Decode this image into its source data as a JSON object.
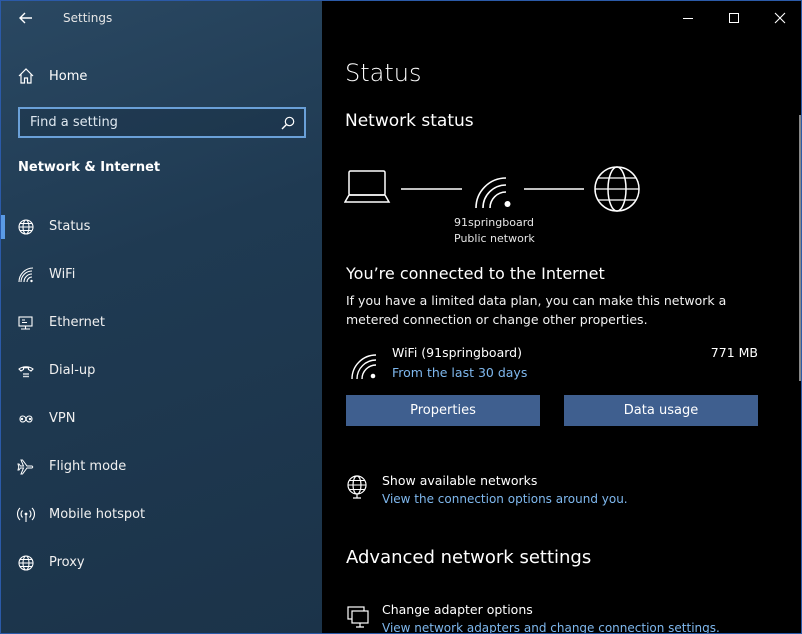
{
  "window": {
    "title": "Settings"
  },
  "sidebar": {
    "home_label": "Home",
    "search_placeholder": "Find a setting",
    "section_title": "Network & Internet",
    "items": [
      {
        "label": "Status",
        "icon": "globe-icon",
        "active": true
      },
      {
        "label": "WiFi",
        "icon": "wifi-icon"
      },
      {
        "label": "Ethernet",
        "icon": "ethernet-icon"
      },
      {
        "label": "Dial-up",
        "icon": "dialup-icon"
      },
      {
        "label": "VPN",
        "icon": "vpn-icon"
      },
      {
        "label": "Flight mode",
        "icon": "airplane-icon"
      },
      {
        "label": "Mobile hotspot",
        "icon": "hotspot-icon"
      },
      {
        "label": "Proxy",
        "icon": "globe-icon"
      }
    ]
  },
  "main": {
    "page_title": "Status",
    "network_status_heading": "Network status",
    "network": {
      "name": "91springboard",
      "type": "Public network"
    },
    "connected_heading": "You’re connected to the Internet",
    "connected_desc": "If you have a limited data plan, you can make this network a metered connection or change other properties.",
    "wifi": {
      "name": "WiFi (91springboard)",
      "period": "From the last 30 days",
      "usage": "771 MB"
    },
    "buttons": {
      "properties": "Properties",
      "data_usage": "Data usage"
    },
    "show_networks": {
      "title": "Show available networks",
      "sub": "View the connection options around you."
    },
    "advanced_heading": "Advanced network settings",
    "adapter": {
      "title": "Change adapter options",
      "sub": "View network adapters and change connection settings."
    }
  },
  "colors": {
    "accent": "#5a9be6",
    "link": "#7fb8ee",
    "button": "#3f5f8f",
    "sidebar_bg": "#1f3a52"
  }
}
